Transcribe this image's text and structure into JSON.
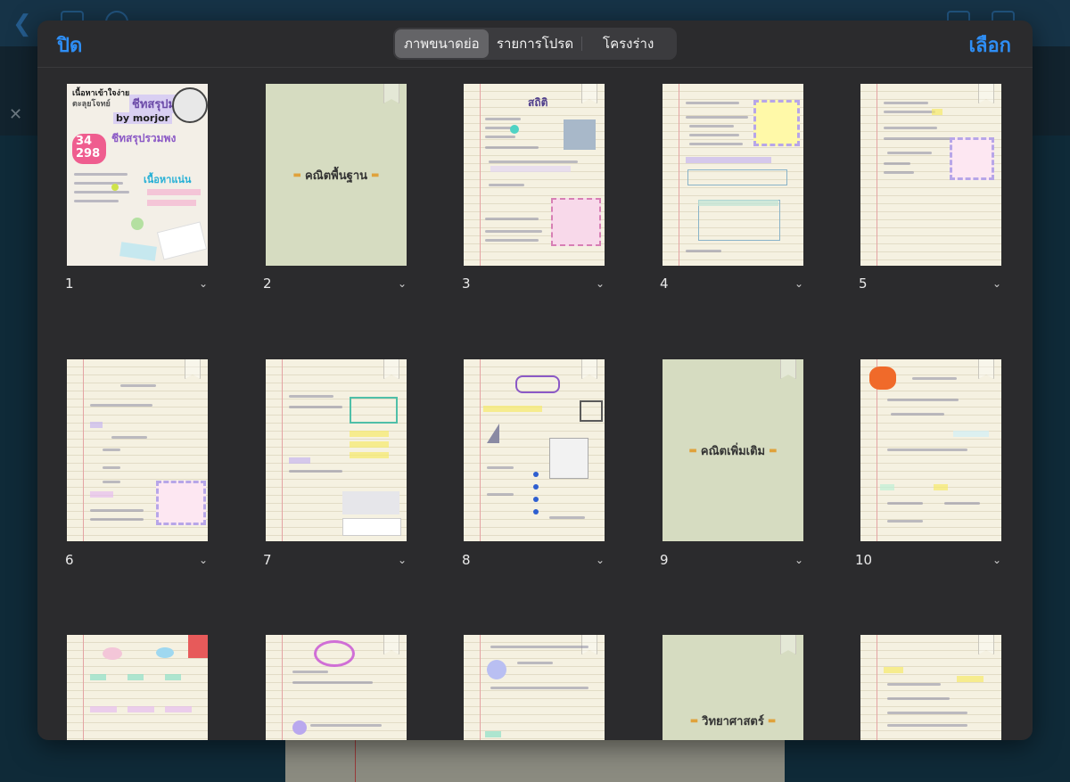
{
  "header": {
    "close_label": "ปิด",
    "select_label": "เลือก",
    "tabs": [
      {
        "label": "ภาพขนาดย่อ",
        "active": true
      },
      {
        "label": "รายการโปรด",
        "active": false
      },
      {
        "label": "โครงร่าง",
        "active": false
      }
    ]
  },
  "pages": [
    {
      "number": "1",
      "kind": "cover",
      "texts": {
        "t1": "เนื้อหาเข้าใจง่าย",
        "t2": "ตะลุยโจทย์",
        "t3": "ชีทสรุปม.3",
        "t4": "by morjor",
        "t5": "34",
        "t6": "298",
        "t7": "ชีทสรุปรวมพง",
        "t8": "เนื้อหาแน่น"
      }
    },
    {
      "number": "2",
      "kind": "divider",
      "label": "คณิตพื้นฐาน"
    },
    {
      "number": "3",
      "kind": "notes",
      "title": "สถิติ"
    },
    {
      "number": "4",
      "kind": "notes",
      "title": ""
    },
    {
      "number": "5",
      "kind": "notes",
      "title": ""
    },
    {
      "number": "6",
      "kind": "notes",
      "title": ""
    },
    {
      "number": "7",
      "kind": "notes",
      "title": ""
    },
    {
      "number": "8",
      "kind": "notes",
      "title": ""
    },
    {
      "number": "9",
      "kind": "divider",
      "label": "คณิตเพิ่มเติม"
    },
    {
      "number": "10",
      "kind": "notes",
      "title": ""
    },
    {
      "number": "",
      "kind": "notes",
      "title": ""
    },
    {
      "number": "",
      "kind": "notes",
      "title": ""
    },
    {
      "number": "",
      "kind": "notes",
      "title": ""
    },
    {
      "number": "",
      "kind": "divider",
      "label": "วิทยาศาสตร์"
    },
    {
      "number": "",
      "kind": "notes",
      "title": ""
    }
  ],
  "icons": {
    "back": "chevron-left-icon",
    "bookmark": "bookmark-icon",
    "chevron": "chevron-down-icon",
    "divider_emoji": "bread-icon"
  },
  "colors": {
    "accent": "#2e8ef5",
    "modal_bg": "#2b2b2d",
    "divider_page": "#d6dcc1"
  }
}
